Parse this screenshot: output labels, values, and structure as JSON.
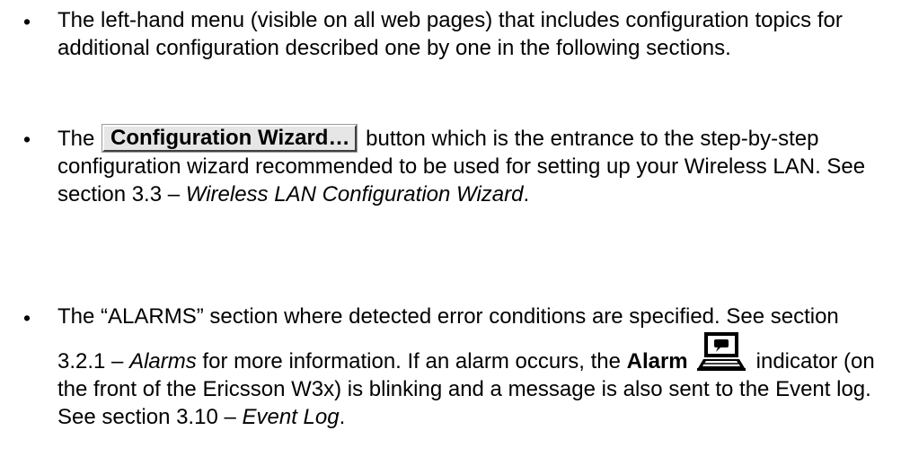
{
  "bullet_glyph": "•",
  "items": [
    {
      "text": "The left-hand menu (visible on all web pages) that includes configuration topics for additional configuration described one by one in the following sections."
    },
    {
      "lead": "The",
      "button_label": "Configuration Wizard…",
      "text": "button which is the entrance to the step-by-step configuration wizard recommended to be used for setting up your Wireless LAN. See section 3.3 –",
      "ref": "Wireless LAN Configuration Wizard",
      "end": "."
    },
    {
      "text": "The “ALARMS” section where detected error conditions are specified. See section 3.2.1 –",
      "ref1": "Alarms",
      "mid1": "for more information. If an alarm occurs, the",
      "alarm_word": "Alarm",
      "icon": "alarm-indicator-icon",
      "mid2": "indicator (on the front of the Ericsson W3x) is blinking and a message is also sent to the Event log. See section 3.10 –",
      "ref2": "Event Log",
      "end": "."
    }
  ]
}
